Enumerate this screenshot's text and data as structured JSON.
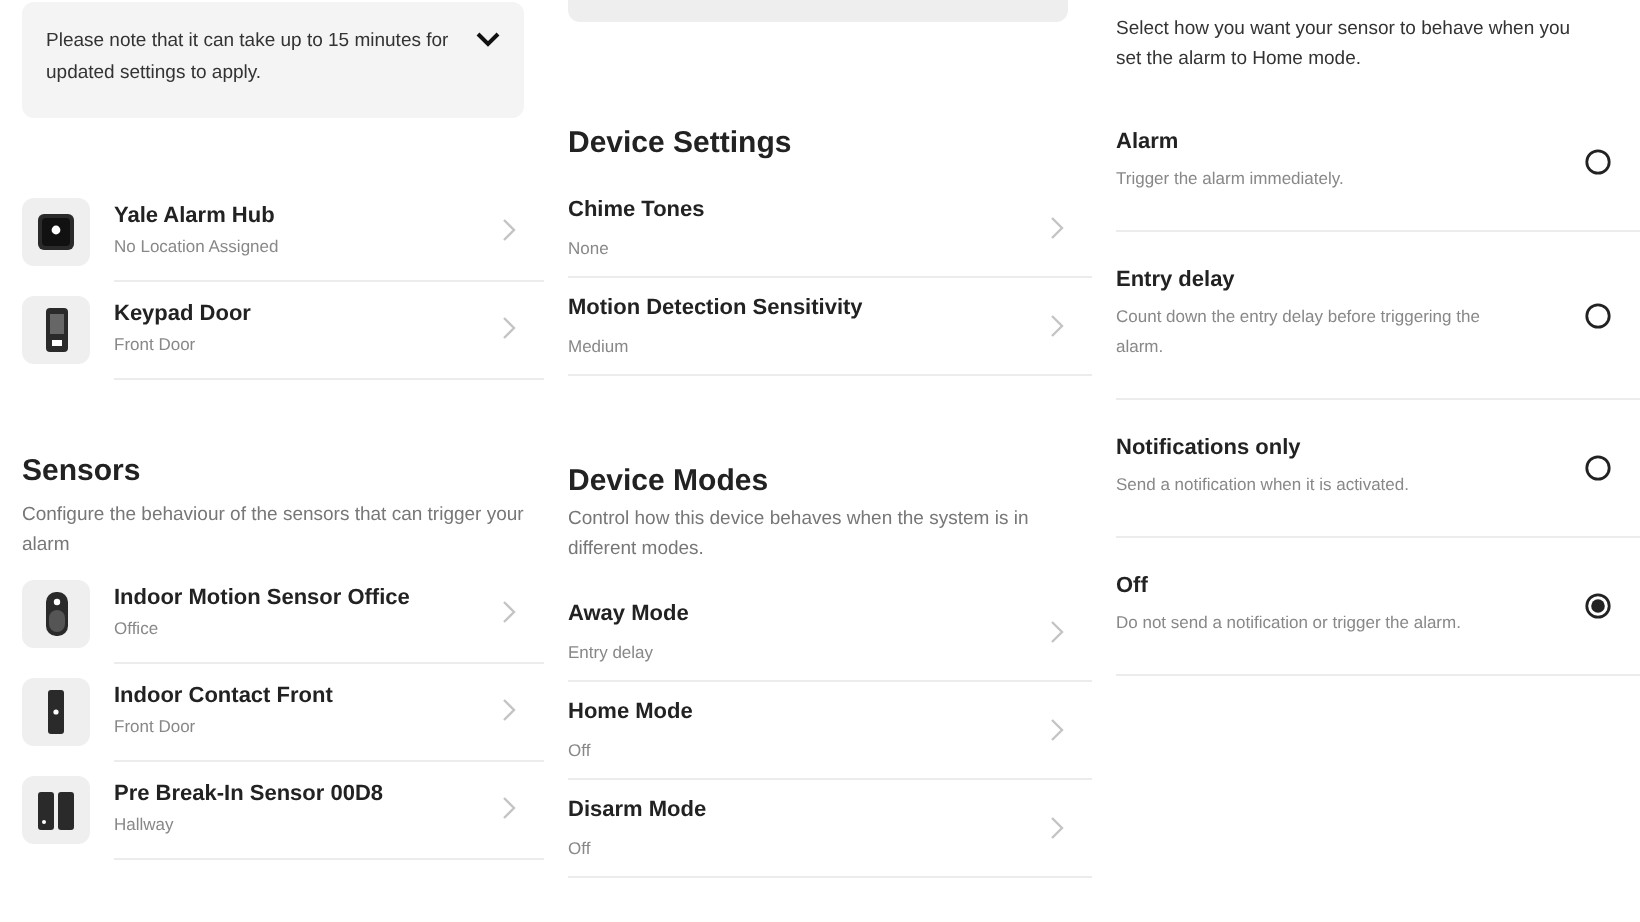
{
  "notice": {
    "text": "Please note that it can take up to 15 minutes for updated settings to apply.",
    "expanded": false
  },
  "devices": [
    {
      "kind": "hub",
      "name": "Yale Alarm Hub",
      "location": "No Location Assigned"
    },
    {
      "kind": "keypad",
      "name": "Keypad Door",
      "location": "Front Door"
    }
  ],
  "sensors": {
    "title": "Sensors",
    "description": "Configure the behaviour of the sensors that can trigger your alarm",
    "items": [
      {
        "kind": "motion",
        "name": "Indoor Motion Sensor Office",
        "location": "Office"
      },
      {
        "kind": "contact",
        "name": "Indoor Contact Front",
        "location": "Front Door"
      },
      {
        "kind": "breakin",
        "name": "Pre Break-In Sensor 00D8",
        "location": "Hallway"
      }
    ]
  },
  "device_settings": {
    "title": "Device Settings",
    "items": [
      {
        "name": "Chime Tones",
        "value": "None"
      },
      {
        "name": "Motion Detection Sensitivity",
        "value": "Medium"
      }
    ]
  },
  "device_modes": {
    "title": "Device Modes",
    "description": "Control how this device behaves when the system is in different modes.",
    "items": [
      {
        "name": "Away Mode",
        "value": "Entry delay"
      },
      {
        "name": "Home Mode",
        "value": "Off"
      },
      {
        "name": "Disarm Mode",
        "value": "Off"
      }
    ]
  },
  "home_mode": {
    "description": "Select how you want your sensor to behave when you set the alarm to Home mode.",
    "options": [
      {
        "label": "Alarm",
        "description": "Trigger the alarm immediately.",
        "selected": false
      },
      {
        "label": "Entry delay",
        "description": "Count down the entry delay before triggering the alarm.",
        "selected": false
      },
      {
        "label": "Notifications only",
        "description": "Send a notification when it is activated.",
        "selected": false
      },
      {
        "label": "Off",
        "description": "Do not send a notification or trigger the alarm.",
        "selected": true
      }
    ]
  }
}
